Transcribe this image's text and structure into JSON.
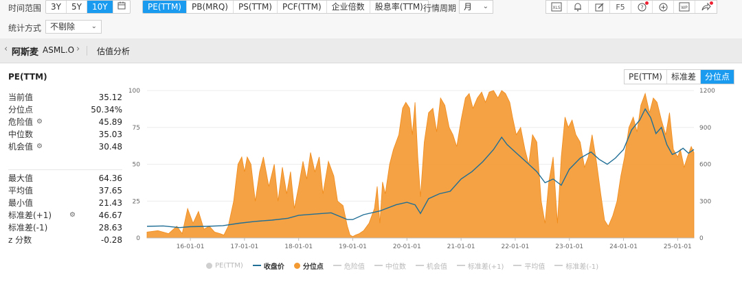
{
  "toolbar": {
    "range_label": "时间范围",
    "range_options": [
      "3Y",
      "5Y",
      "10Y"
    ],
    "range_active": "10Y",
    "metrics": [
      "PE(TTM)",
      "PB(MRQ)",
      "PS(TTM)",
      "PCF(TTM)",
      "企业倍数",
      "股息率(TTM)"
    ],
    "metric_active": "PE(TTM)",
    "period_label": "行情周期",
    "period_value": "月",
    "stat_label": "统计方式",
    "stat_value": "不剔除",
    "f5": "F5"
  },
  "breadcrumb": {
    "name": "阿斯麦",
    "code": "ASML.O",
    "page": "估值分析"
  },
  "stats": {
    "title": "PE(TTM)",
    "group1": [
      {
        "label": "当前值",
        "value": "35.12",
        "gear": false
      },
      {
        "label": "分位点",
        "value": "50.34%",
        "gear": false
      },
      {
        "label": "危险值",
        "value": "45.89",
        "gear": true
      },
      {
        "label": "中位数",
        "value": "35.03",
        "gear": false
      },
      {
        "label": "机会值",
        "value": "30.48",
        "gear": true
      }
    ],
    "group2": [
      {
        "label": "最大值",
        "value": "64.36",
        "gear": false
      },
      {
        "label": "平均值",
        "value": "37.65",
        "gear": false
      },
      {
        "label": "最小值",
        "value": "21.43",
        "gear": false
      },
      {
        "label": "标准差(+1)",
        "value": "46.67",
        "gear": true
      },
      {
        "label": "标准差(-1)",
        "value": "28.63",
        "gear": false
      },
      {
        "label": "z 分数",
        "value": "-0.28",
        "gear": false
      }
    ]
  },
  "view_tabs": [
    "PE(TTM)",
    "标准差",
    "分位点"
  ],
  "view_active": "分位点",
  "colors": {
    "accent": "#1a9bf0",
    "percentile": "#f39a33",
    "price": "#1f6e96"
  },
  "chart_data": {
    "type": "area",
    "x_ticks": [
      "16-01-01",
      "17-01-01",
      "18-01-01",
      "19-01-01",
      "20-01-01",
      "21-01-01",
      "22-01-01",
      "23-01-01",
      "24-01-01",
      "25-01-01"
    ],
    "x_range": [
      2015.2,
      2025.3
    ],
    "y_left": {
      "ticks": [
        0,
        25,
        50,
        75,
        100
      ],
      "range": [
        0,
        100
      ]
    },
    "y_right": {
      "ticks": [
        0,
        300,
        600,
        900,
        1200
      ],
      "range": [
        0,
        1200
      ]
    },
    "series": [
      {
        "name": "分位点",
        "axis": "left",
        "points": [
          [
            2015.2,
            4
          ],
          [
            2015.4,
            5
          ],
          [
            2015.6,
            3
          ],
          [
            2015.75,
            8
          ],
          [
            2015.85,
            3
          ],
          [
            2015.95,
            20
          ],
          [
            2016.05,
            10
          ],
          [
            2016.15,
            18
          ],
          [
            2016.25,
            6
          ],
          [
            2016.35,
            8
          ],
          [
            2016.45,
            4
          ],
          [
            2016.55,
            3
          ],
          [
            2016.62,
            2
          ],
          [
            2016.7,
            8
          ],
          [
            2016.8,
            25
          ],
          [
            2016.88,
            50
          ],
          [
            2016.95,
            55
          ],
          [
            2017.0,
            45
          ],
          [
            2017.05,
            55
          ],
          [
            2017.12,
            50
          ],
          [
            2017.2,
            25
          ],
          [
            2017.28,
            45
          ],
          [
            2017.35,
            55
          ],
          [
            2017.45,
            35
          ],
          [
            2017.55,
            50
          ],
          [
            2017.62,
            25
          ],
          [
            2017.7,
            48
          ],
          [
            2017.78,
            30
          ],
          [
            2017.85,
            45
          ],
          [
            2017.92,
            20
          ],
          [
            2018.0,
            35
          ],
          [
            2018.08,
            52
          ],
          [
            2018.15,
            40
          ],
          [
            2018.22,
            58
          ],
          [
            2018.3,
            45
          ],
          [
            2018.38,
            55
          ],
          [
            2018.45,
            30
          ],
          [
            2018.55,
            52
          ],
          [
            2018.65,
            42
          ],
          [
            2018.72,
            25
          ],
          [
            2018.82,
            22
          ],
          [
            2018.9,
            8
          ],
          [
            2018.95,
            2
          ],
          [
            2019.0,
            1
          ],
          [
            2019.05,
            2
          ],
          [
            2019.12,
            3
          ],
          [
            2019.2,
            5
          ],
          [
            2019.3,
            10
          ],
          [
            2019.4,
            20
          ],
          [
            2019.45,
            35
          ],
          [
            2019.5,
            10
          ],
          [
            2019.55,
            38
          ],
          [
            2019.6,
            30
          ],
          [
            2019.68,
            50
          ],
          [
            2019.75,
            60
          ],
          [
            2019.85,
            70
          ],
          [
            2019.92,
            88
          ],
          [
            2019.98,
            92
          ],
          [
            2020.05,
            88
          ],
          [
            2020.1,
            70
          ],
          [
            2020.15,
            92
          ],
          [
            2020.2,
            55
          ],
          [
            2020.22,
            45
          ],
          [
            2020.25,
            28
          ],
          [
            2020.32,
            65
          ],
          [
            2020.4,
            85
          ],
          [
            2020.48,
            88
          ],
          [
            2020.55,
            72
          ],
          [
            2020.62,
            95
          ],
          [
            2020.7,
            90
          ],
          [
            2020.78,
            75
          ],
          [
            2020.85,
            70
          ],
          [
            2020.92,
            62
          ],
          [
            2021.0,
            80
          ],
          [
            2021.08,
            95
          ],
          [
            2021.15,
            98
          ],
          [
            2021.22,
            88
          ],
          [
            2021.3,
            95
          ],
          [
            2021.38,
            99
          ],
          [
            2021.45,
            92
          ],
          [
            2021.52,
            99
          ],
          [
            2021.6,
            100
          ],
          [
            2021.68,
            95
          ],
          [
            2021.75,
            100
          ],
          [
            2021.82,
            98
          ],
          [
            2021.9,
            92
          ],
          [
            2021.95,
            82
          ],
          [
            2022.02,
            70
          ],
          [
            2022.1,
            75
          ],
          [
            2022.18,
            60
          ],
          [
            2022.25,
            50
          ],
          [
            2022.32,
            70
          ],
          [
            2022.4,
            65
          ],
          [
            2022.48,
            25
          ],
          [
            2022.55,
            10
          ],
          [
            2022.62,
            38
          ],
          [
            2022.7,
            55
          ],
          [
            2022.78,
            10
          ],
          [
            2022.85,
            55
          ],
          [
            2022.92,
            82
          ],
          [
            2022.98,
            75
          ],
          [
            2023.05,
            80
          ],
          [
            2023.12,
            70
          ],
          [
            2023.2,
            65
          ],
          [
            2023.28,
            48
          ],
          [
            2023.35,
            55
          ],
          [
            2023.42,
            70
          ],
          [
            2023.5,
            52
          ],
          [
            2023.58,
            30
          ],
          [
            2023.65,
            12
          ],
          [
            2023.72,
            8
          ],
          [
            2023.8,
            15
          ],
          [
            2023.88,
            25
          ],
          [
            2023.95,
            42
          ],
          [
            2024.02,
            55
          ],
          [
            2024.1,
            75
          ],
          [
            2024.18,
            82
          ],
          [
            2024.25,
            72
          ],
          [
            2024.32,
            90
          ],
          [
            2024.4,
            98
          ],
          [
            2024.48,
            85
          ],
          [
            2024.55,
            95
          ],
          [
            2024.62,
            92
          ],
          [
            2024.7,
            80
          ],
          [
            2024.78,
            70
          ],
          [
            2024.85,
            85
          ],
          [
            2024.92,
            60
          ],
          [
            2025.0,
            55
          ],
          [
            2025.05,
            60
          ],
          [
            2025.12,
            48
          ],
          [
            2025.18,
            55
          ],
          [
            2025.25,
            62
          ],
          [
            2025.3,
            58
          ]
        ]
      },
      {
        "name": "收盘价",
        "axis": "right",
        "points": [
          [
            2015.2,
            95
          ],
          [
            2015.5,
            98
          ],
          [
            2015.8,
            85
          ],
          [
            2016.0,
            92
          ],
          [
            2016.3,
            95
          ],
          [
            2016.6,
            100
          ],
          [
            2016.9,
            120
          ],
          [
            2017.2,
            135
          ],
          [
            2017.5,
            145
          ],
          [
            2017.8,
            160
          ],
          [
            2018.0,
            185
          ],
          [
            2018.3,
            195
          ],
          [
            2018.6,
            205
          ],
          [
            2018.9,
            150
          ],
          [
            2019.0,
            150
          ],
          [
            2019.2,
            190
          ],
          [
            2019.5,
            220
          ],
          [
            2019.8,
            270
          ],
          [
            2020.0,
            290
          ],
          [
            2020.15,
            270
          ],
          [
            2020.25,
            200
          ],
          [
            2020.4,
            320
          ],
          [
            2020.6,
            360
          ],
          [
            2020.8,
            380
          ],
          [
            2021.0,
            480
          ],
          [
            2021.2,
            540
          ],
          [
            2021.4,
            620
          ],
          [
            2021.6,
            720
          ],
          [
            2021.75,
            820
          ],
          [
            2021.85,
            760
          ],
          [
            2022.0,
            700
          ],
          [
            2022.2,
            620
          ],
          [
            2022.4,
            540
          ],
          [
            2022.55,
            450
          ],
          [
            2022.7,
            480
          ],
          [
            2022.85,
            430
          ],
          [
            2023.0,
            560
          ],
          [
            2023.2,
            650
          ],
          [
            2023.4,
            700
          ],
          [
            2023.55,
            640
          ],
          [
            2023.7,
            600
          ],
          [
            2023.85,
            650
          ],
          [
            2024.0,
            720
          ],
          [
            2024.15,
            880
          ],
          [
            2024.3,
            960
          ],
          [
            2024.4,
            1050
          ],
          [
            2024.5,
            980
          ],
          [
            2024.6,
            850
          ],
          [
            2024.7,
            900
          ],
          [
            2024.8,
            760
          ],
          [
            2024.9,
            680
          ],
          [
            2025.0,
            700
          ],
          [
            2025.1,
            730
          ],
          [
            2025.2,
            690
          ],
          [
            2025.3,
            720
          ]
        ]
      }
    ],
    "legend": [
      "PE(TTM)",
      "收盘价",
      "分位点",
      "危险值",
      "中位数",
      "机会值",
      "标准差(+1)",
      "平均值",
      "标准差(-1)"
    ],
    "legend_active": [
      "收盘价",
      "分位点"
    ],
    "legend_placement": "bottom"
  }
}
